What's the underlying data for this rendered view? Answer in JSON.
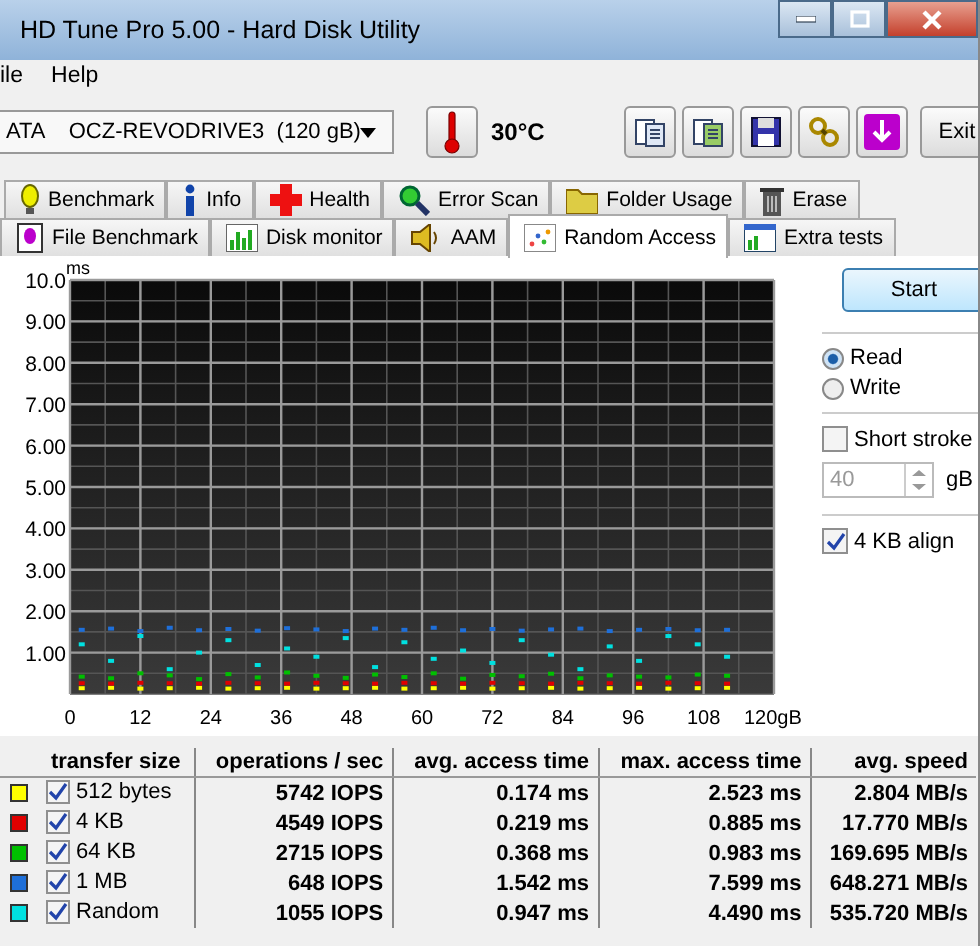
{
  "window": {
    "title": "HD Tune Pro 5.00 - Hard Disk Utility"
  },
  "menu": [
    "ile",
    "Help"
  ],
  "toolbar": {
    "drive": "ATA    OCZ-REVODRIVE3  (120 gB)",
    "temperature": "30°C",
    "exit": "Exit"
  },
  "tabs_top": [
    {
      "label": "Benchmark",
      "selected": false
    },
    {
      "label": "Info",
      "selected": false
    },
    {
      "label": "Health",
      "selected": false
    },
    {
      "label": "Error Scan",
      "selected": false
    },
    {
      "label": "Folder Usage",
      "selected": false
    },
    {
      "label": "Erase",
      "selected": false
    }
  ],
  "tabs_bottom": [
    {
      "label": "File Benchmark",
      "selected": false
    },
    {
      "label": "Disk monitor",
      "selected": false
    },
    {
      "label": "AAM",
      "selected": false
    },
    {
      "label": "Random Access",
      "selected": true
    },
    {
      "label": "Extra tests",
      "selected": false
    }
  ],
  "chart": {
    "chart_data": {
      "type": "scatter",
      "grid": true,
      "ylabel": "ms",
      "xlim": [
        0,
        120
      ],
      "ylim": [
        0,
        10
      ],
      "xticks": [
        0,
        12,
        24,
        36,
        48,
        60,
        72,
        84,
        96,
        108,
        {
          "value": 120,
          "label": "120gB"
        }
      ],
      "yticks": [
        {
          "value": 1,
          "label": "1.00"
        },
        {
          "value": 2,
          "label": "2.00"
        },
        {
          "value": 3,
          "label": "3.00"
        },
        {
          "value": 4,
          "label": "4.00"
        },
        {
          "value": 5,
          "label": "5.00"
        },
        {
          "value": 6,
          "label": "6.00"
        },
        {
          "value": 7,
          "label": "7.00"
        },
        {
          "value": 8,
          "label": "8.00"
        },
        {
          "value": 9,
          "label": "9.00"
        },
        {
          "value": 10,
          "label": "10.0"
        }
      ],
      "x": [
        2,
        7,
        12,
        17,
        22,
        27,
        32,
        37,
        42,
        47,
        52,
        57,
        62,
        67,
        72,
        77,
        82,
        87,
        92,
        97,
        102,
        107,
        112
      ],
      "series": [
        {
          "color": "#ffff00",
          "values": [
            0.14,
            0.15,
            0.13,
            0.14,
            0.15,
            0.13,
            0.14,
            0.15,
            0.13,
            0.14,
            0.15,
            0.13,
            0.14,
            0.15,
            0.13,
            0.14,
            0.15,
            0.13,
            0.14,
            0.15,
            0.13,
            0.14,
            0.15
          ]
        },
        {
          "color": "#e00000",
          "values": [
            0.26,
            0.25,
            0.27,
            0.26,
            0.25,
            0.27,
            0.26,
            0.25,
            0.27,
            0.26,
            0.25,
            0.27,
            0.26,
            0.25,
            0.27,
            0.26,
            0.25,
            0.27,
            0.26,
            0.25,
            0.27,
            0.26,
            0.25
          ]
        },
        {
          "color": "#00c000",
          "values": [
            0.42,
            0.38,
            0.5,
            0.45,
            0.36,
            0.48,
            0.4,
            0.52,
            0.44,
            0.39,
            0.47,
            0.41,
            0.5,
            0.37,
            0.46,
            0.43,
            0.49,
            0.38,
            0.45,
            0.42,
            0.4,
            0.47,
            0.44
          ]
        },
        {
          "color": "#1e6fd9",
          "values": [
            1.55,
            1.58,
            1.52,
            1.6,
            1.54,
            1.57,
            1.53,
            1.59,
            1.56,
            1.52,
            1.58,
            1.55,
            1.6,
            1.54,
            1.57,
            1.53,
            1.56,
            1.58,
            1.52,
            1.55,
            1.57,
            1.54,
            1.55
          ]
        },
        {
          "color": "#00e0e0",
          "values": [
            1.2,
            0.8,
            1.4,
            0.6,
            1.0,
            1.3,
            0.7,
            1.1,
            0.9,
            1.35,
            0.65,
            1.25,
            0.85,
            1.05,
            0.75,
            1.3,
            0.95,
            0.6,
            1.15,
            0.8,
            1.4,
            1.2,
            0.9
          ]
        }
      ]
    }
  },
  "controls": {
    "start": "Start",
    "modes": [
      {
        "label": "Read",
        "selected": true
      },
      {
        "label": "Write",
        "selected": false
      }
    ],
    "short_stroke": {
      "label": "Short stroke",
      "checked": false
    },
    "stroke_size": {
      "value": "40",
      "unit": "gB",
      "disabled": true
    },
    "align": {
      "label": "4 KB align",
      "checked": true
    }
  },
  "table": {
    "columns": [
      "transfer size",
      "operations / sec",
      "avg. access time",
      "max. access time",
      "avg. speed"
    ],
    "rows": [
      {
        "color": "#ffff00",
        "checked": true,
        "cells": [
          "512 bytes",
          "5742 IOPS",
          "0.174 ms",
          "2.523 ms",
          "2.804 MB/s"
        ]
      },
      {
        "color": "#e00000",
        "checked": true,
        "cells": [
          "4 KB",
          "4549 IOPS",
          "0.219 ms",
          "0.885 ms",
          "17.770 MB/s"
        ]
      },
      {
        "color": "#00c000",
        "checked": true,
        "cells": [
          "64 KB",
          "2715 IOPS",
          "0.368 ms",
          "0.983 ms",
          "169.695 MB/s"
        ]
      },
      {
        "color": "#1e6fd9",
        "checked": true,
        "cells": [
          "1 MB",
          "648 IOPS",
          "1.542 ms",
          "7.599 ms",
          "648.271 MB/s"
        ]
      },
      {
        "color": "#00e0e0",
        "checked": true,
        "cells": [
          "Random",
          "1055 IOPS",
          "0.947 ms",
          "4.490 ms",
          "535.720 MB/s"
        ]
      }
    ]
  }
}
